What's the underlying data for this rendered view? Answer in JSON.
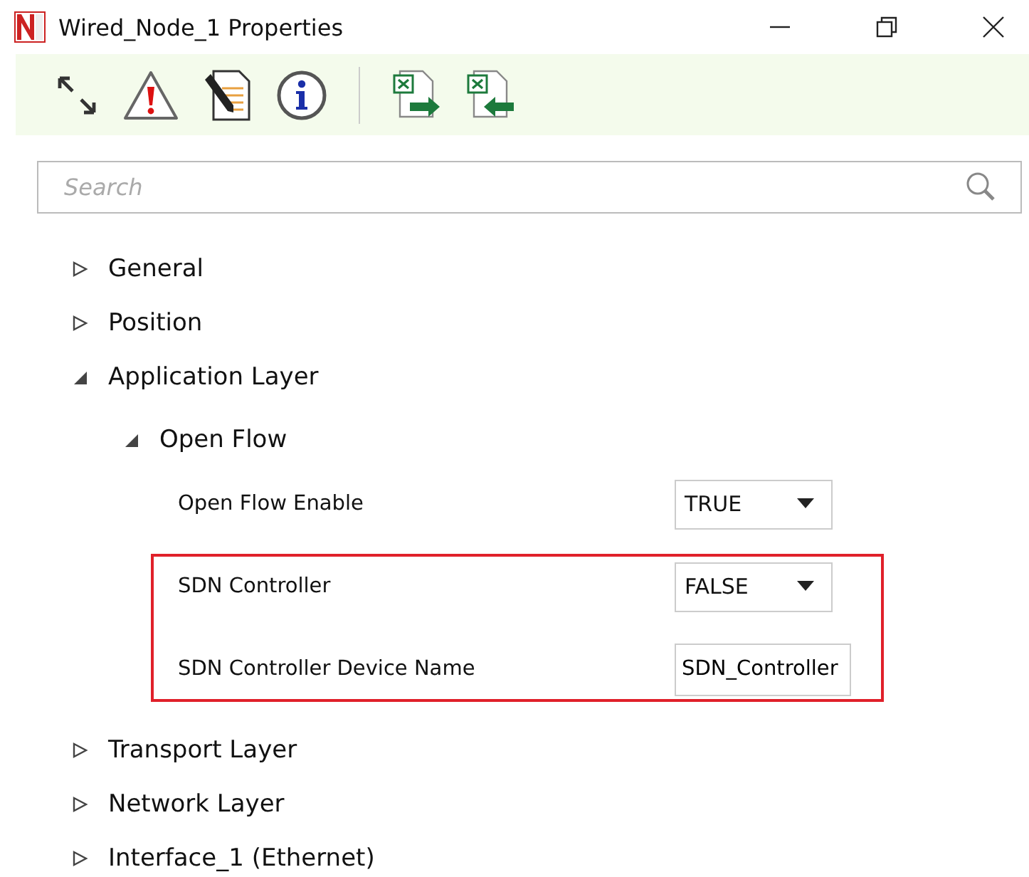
{
  "window": {
    "title": "Wired_Node_1 Properties"
  },
  "toolbar": {
    "buttons": [
      {
        "kind": "expand"
      },
      {
        "kind": "warning"
      },
      {
        "kind": "edit"
      },
      {
        "kind": "info"
      },
      {
        "kind": "separator"
      },
      {
        "kind": "export"
      },
      {
        "kind": "import"
      }
    ]
  },
  "search": {
    "placeholder": "Search"
  },
  "tree": [
    {
      "label": "General",
      "expanded": false
    },
    {
      "label": "Position",
      "expanded": false
    },
    {
      "label": "Application Layer",
      "expanded": true,
      "children": [
        {
          "label": "Open Flow",
          "expanded": true,
          "property_groups": [
            {
              "highlighted": false,
              "properties": [
                {
                  "label": "Open Flow Enable",
                  "kind": "dropdown",
                  "value": "TRUE"
                }
              ]
            },
            {
              "highlighted": true,
              "properties": [
                {
                  "label": "SDN Controller",
                  "kind": "dropdown",
                  "value": "FALSE"
                },
                {
                  "label": "SDN Controller Device Name",
                  "kind": "text",
                  "value": "SDN_Controller"
                }
              ]
            }
          ]
        }
      ]
    },
    {
      "label": "Transport Layer",
      "expanded": false
    },
    {
      "label": "Network Layer",
      "expanded": false
    },
    {
      "label": "Interface_1 (Ethernet)",
      "expanded": false
    }
  ]
}
